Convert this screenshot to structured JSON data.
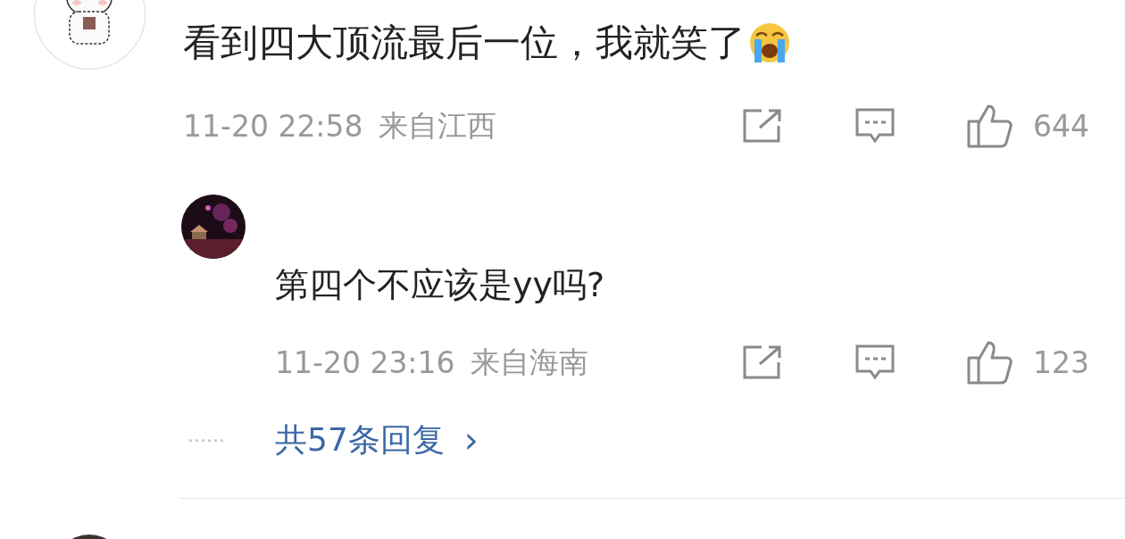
{
  "comment": {
    "text": "看到四大顶流最后一位，我就笑了",
    "time": "11-20 22:58",
    "location": "来自江西",
    "likes": "644"
  },
  "reply": {
    "text": "第四个不应该是yy吗?",
    "time": "11-20 23:16",
    "location": "来自海南",
    "likes": "123"
  },
  "more_replies": {
    "dots": "······",
    "label": "共57条回复",
    "chevron": "›"
  }
}
